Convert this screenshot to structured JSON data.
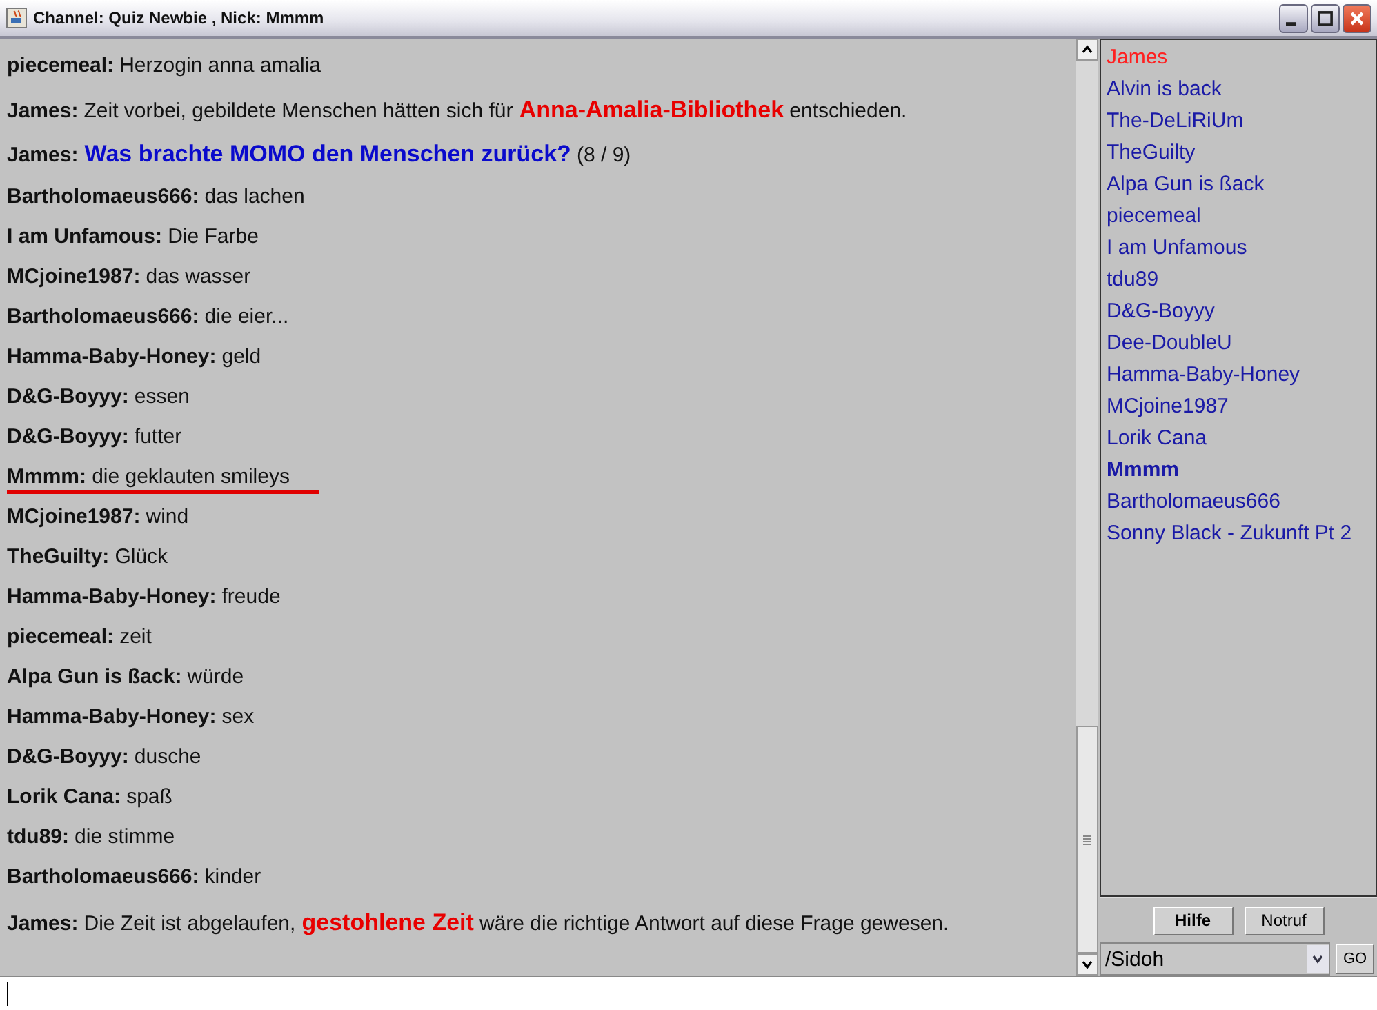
{
  "window": {
    "title": "Channel: Quiz Newbie ,  Nick: Mmmm"
  },
  "messages": [
    {
      "nick": "piecemeal:",
      "parts": [
        {
          "kind": "plain",
          "text": "Herzogin anna amalia"
        }
      ],
      "marked": false
    },
    {
      "nick": "James:",
      "parts": [
        {
          "kind": "plain",
          "text": "Zeit vorbei, gebildete Menschen hätten sich für"
        },
        {
          "kind": "answer",
          "text": "Anna-Amalia-Bibliothek"
        },
        {
          "kind": "plain",
          "text": "entschieden."
        }
      ],
      "marked": false
    },
    {
      "nick": "James:",
      "parts": [
        {
          "kind": "question",
          "text": "Was brachte MOMO den Menschen zurück?"
        },
        {
          "kind": "plain",
          "text": "(8 / 9)"
        }
      ],
      "marked": false
    },
    {
      "nick": "Bartholomaeus666:",
      "parts": [
        {
          "kind": "plain",
          "text": "das lachen"
        }
      ],
      "marked": false
    },
    {
      "nick": "I am Unfamous:",
      "parts": [
        {
          "kind": "plain",
          "text": "Die Farbe"
        }
      ],
      "marked": false
    },
    {
      "nick": "MCjoine1987:",
      "parts": [
        {
          "kind": "plain",
          "text": "das wasser"
        }
      ],
      "marked": false
    },
    {
      "nick": "Bartholomaeus666:",
      "parts": [
        {
          "kind": "plain",
          "text": "die eier..."
        }
      ],
      "marked": false
    },
    {
      "nick": "Hamma-Baby-Honey:",
      "parts": [
        {
          "kind": "plain",
          "text": "geld"
        }
      ],
      "marked": false
    },
    {
      "nick": "D&G-Boyyy:",
      "parts": [
        {
          "kind": "plain",
          "text": "essen"
        }
      ],
      "marked": false
    },
    {
      "nick": "D&G-Boyyy:",
      "parts": [
        {
          "kind": "plain",
          "text": "futter"
        }
      ],
      "marked": false
    },
    {
      "nick": "Mmmm:",
      "parts": [
        {
          "kind": "plain",
          "text": "die geklauten smileys"
        }
      ],
      "marked": true
    },
    {
      "nick": "MCjoine1987:",
      "parts": [
        {
          "kind": "plain",
          "text": "wind"
        }
      ],
      "marked": false
    },
    {
      "nick": "TheGuilty:",
      "parts": [
        {
          "kind": "plain",
          "text": "Glück"
        }
      ],
      "marked": false
    },
    {
      "nick": "Hamma-Baby-Honey:",
      "parts": [
        {
          "kind": "plain",
          "text": "freude"
        }
      ],
      "marked": false
    },
    {
      "nick": "piecemeal:",
      "parts": [
        {
          "kind": "plain",
          "text": "zeit"
        }
      ],
      "marked": false
    },
    {
      "nick": "Alpa Gun is ßack:",
      "parts": [
        {
          "kind": "plain",
          "text": "würde"
        }
      ],
      "marked": false
    },
    {
      "nick": "Hamma-Baby-Honey:",
      "parts": [
        {
          "kind": "plain",
          "text": "sex"
        }
      ],
      "marked": false
    },
    {
      "nick": "D&G-Boyyy:",
      "parts": [
        {
          "kind": "plain",
          "text": "dusche"
        }
      ],
      "marked": false
    },
    {
      "nick": "Lorik Cana:",
      "parts": [
        {
          "kind": "plain",
          "text": "spaß"
        }
      ],
      "marked": false
    },
    {
      "nick": "tdu89:",
      "parts": [
        {
          "kind": "plain",
          "text": "die stimme"
        }
      ],
      "marked": false
    },
    {
      "nick": "Bartholomaeus666:",
      "parts": [
        {
          "kind": "plain",
          "text": "kinder"
        }
      ],
      "marked": false
    },
    {
      "nick": "James:",
      "parts": [
        {
          "kind": "plain",
          "text": "Die Zeit ist abgelaufen,"
        },
        {
          "kind": "answer",
          "text": "gestohlene Zeit"
        },
        {
          "kind": "plain",
          "text": "wäre die richtige Antwort auf diese Frage gewesen."
        }
      ],
      "marked": false
    }
  ],
  "users": [
    {
      "name": "James",
      "color": "#ff2020",
      "self": false
    },
    {
      "name": "Alvin is back",
      "color": "#1a1aa6",
      "self": false
    },
    {
      "name": "The-DeLiRiUm",
      "color": "#1a1aa6",
      "self": false
    },
    {
      "name": "TheGuilty",
      "color": "#1a1aa6",
      "self": false
    },
    {
      "name": "Alpa Gun is ßack",
      "color": "#1a1aa6",
      "self": false
    },
    {
      "name": "piecemeal",
      "color": "#1a1aa6",
      "self": false
    },
    {
      "name": "I am Unfamous",
      "color": "#1a1aa6",
      "self": false
    },
    {
      "name": "tdu89",
      "color": "#1a1aa6",
      "self": false
    },
    {
      "name": "D&G-Boyyy",
      "color": "#1a1aa6",
      "self": false
    },
    {
      "name": "Dee-DoubleU",
      "color": "#1a1aa6",
      "self": false
    },
    {
      "name": "Hamma-Baby-Honey",
      "color": "#1a1aa6",
      "self": false
    },
    {
      "name": "MCjoine1987",
      "color": "#1a1aa6",
      "self": false
    },
    {
      "name": "Lorik Cana",
      "color": "#1a1aa6",
      "self": false
    },
    {
      "name": "Mmmm",
      "color": "#1a1aa6",
      "self": true
    },
    {
      "name": "Bartholomaeus666",
      "color": "#1a1aa6",
      "self": false
    },
    {
      "name": "Sonny Black - Zukunft Pt 2",
      "color": "#1a1aa6",
      "self": false
    }
  ],
  "buttons": [
    {
      "label": "Hilfe",
      "bold": true
    },
    {
      "label": "Notruf",
      "bold": false
    }
  ],
  "command": {
    "value": "/Sidoh"
  },
  "go_button": "GO"
}
